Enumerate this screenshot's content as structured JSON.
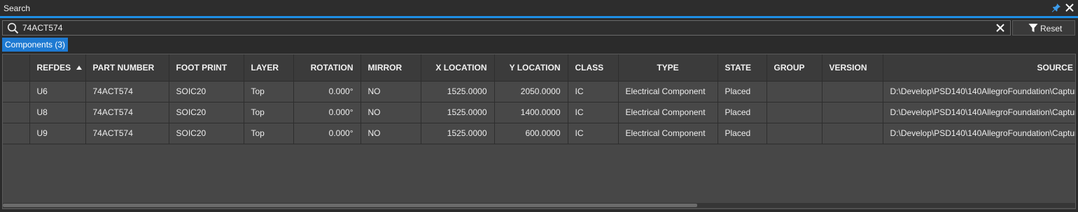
{
  "window": {
    "title": "Search",
    "icons": {
      "pin": "pin-icon",
      "close": "close-icon"
    }
  },
  "search": {
    "value": "74ACT574",
    "placeholder": "",
    "reset_label": "Reset"
  },
  "tabs": [
    {
      "label": "Components (3)"
    }
  ],
  "table": {
    "columns": [
      {
        "label": ""
      },
      {
        "label": "REFDES"
      },
      {
        "label": "PART NUMBER"
      },
      {
        "label": "FOOT PRINT"
      },
      {
        "label": "LAYER"
      },
      {
        "label": "ROTATION"
      },
      {
        "label": "MIRROR"
      },
      {
        "label": "X LOCATION"
      },
      {
        "label": "Y LOCATION"
      },
      {
        "label": "CLASS"
      },
      {
        "label": "TYPE"
      },
      {
        "label": "STATE"
      },
      {
        "label": "GROUP"
      },
      {
        "label": "VERSION"
      },
      {
        "label": "SOURCE"
      }
    ],
    "sort_column": "REFDES",
    "sort_direction": "ascending",
    "rows": [
      [
        "",
        "U6",
        "74ACT574",
        "SOIC20",
        "Top",
        "0.000°",
        "NO",
        "1525.0000",
        "2050.0000",
        "IC",
        "Electrical Component",
        "Placed",
        "",
        "",
        "D:\\Develop\\PSD140\\140AllegroFoundation\\Captur"
      ],
      [
        "",
        "U8",
        "74ACT574",
        "SOIC20",
        "Top",
        "0.000°",
        "NO",
        "1525.0000",
        "1400.0000",
        "IC",
        "Electrical Component",
        "Placed",
        "",
        "",
        "D:\\Develop\\PSD140\\140AllegroFoundation\\Captur"
      ],
      [
        "",
        "U9",
        "74ACT574",
        "SOIC20",
        "Top",
        "0.000°",
        "NO",
        "1525.0000",
        "600.0000",
        "IC",
        "Electrical Component",
        "Placed",
        "",
        "",
        "D:\\Develop\\PSD140\\140AllegroFoundation\\Captur"
      ]
    ]
  },
  "colors": {
    "accent": "#1e8fe6",
    "tab_active": "#1e7ad2",
    "background": "#2b2b2b",
    "grid_background": "#474747"
  }
}
